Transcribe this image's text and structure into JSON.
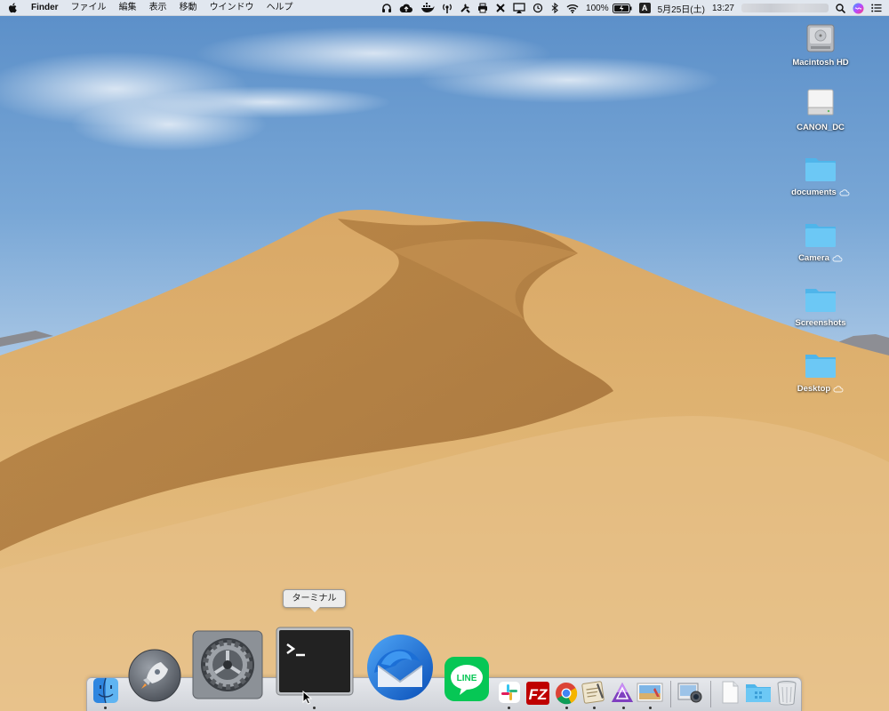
{
  "menubar": {
    "app_name": "Finder",
    "menus": [
      "ファイル",
      "編集",
      "表示",
      "移動",
      "ウインドウ",
      "ヘルプ"
    ],
    "battery": "100%",
    "input_mode": "A",
    "date": "5月25日(土)",
    "time": "13:27",
    "status_icons": [
      "headphones-icon",
      "cloud-upload-icon",
      "docker-icon",
      "antenna-icon",
      "tools-icon",
      "printer-icon",
      "x-app-icon",
      "airplay-icon",
      "time-machine-icon",
      "bluetooth-icon",
      "wifi-icon",
      "battery-icon"
    ]
  },
  "desktop_icons": [
    {
      "label": "Macintosh HD",
      "icon": "hard-drive-icon"
    },
    {
      "label": "CANON_DC",
      "icon": "external-drive-icon"
    },
    {
      "label": "documents",
      "icon": "folder-icon",
      "cloud": true
    },
    {
      "label": "Camera",
      "icon": "folder-icon",
      "cloud": true
    },
    {
      "label": "Screenshots",
      "icon": "folder-icon",
      "cloud": false
    },
    {
      "label": "Desktop",
      "icon": "folder-icon",
      "cloud": true
    }
  ],
  "tooltip": "ターミナル",
  "dock": {
    "apps": [
      "Finder",
      "Launchpad",
      "System Preferences",
      "Terminal",
      "Thunderbird",
      "LINE",
      "Slack",
      "FileZilla",
      "Chrome",
      "Script Editor",
      "Affinity Designer",
      "Preview",
      "Image Capture"
    ],
    "right": [
      "Documents stack",
      "Downloads folder",
      "Trash"
    ]
  },
  "colors": {
    "sky_top": "#5b8fc9",
    "sky_bottom": "#c7dbee",
    "sand_light": "#e3b879",
    "sand_dark": "#b07d45",
    "folder_blue": "#5cc1f2"
  }
}
